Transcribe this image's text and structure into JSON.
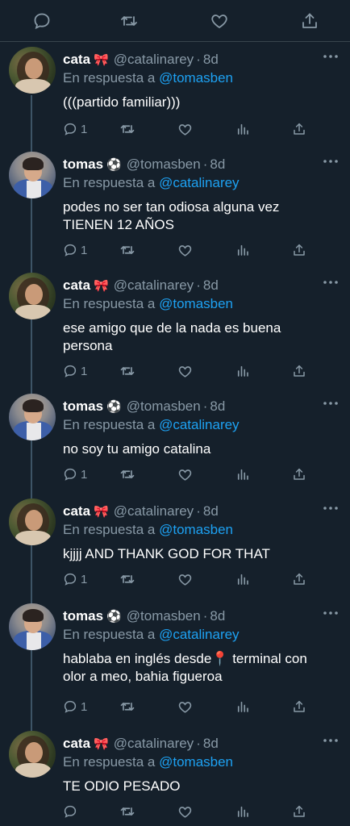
{
  "colors": {
    "background": "#15202b",
    "text": "#ffffff",
    "muted": "#8899a6",
    "link": "#1da1f2",
    "divider": "#38444d"
  },
  "top_action_bar": {
    "icons": [
      "reply-icon",
      "retweet-icon",
      "like-icon",
      "share-icon"
    ]
  },
  "tweets": [
    {
      "name": "cata",
      "emoji": "🎀",
      "handle": "@catalinarey",
      "time": "8d",
      "reply_label": "En respuesta a",
      "reply_to": "@tomasben",
      "text_lines": [
        "(((partido familiar)))"
      ],
      "reply_count": "1"
    },
    {
      "name": "tomas",
      "emoji": "⚽",
      "handle": "@tomasben",
      "time": "8d",
      "reply_label": "En respuesta a",
      "reply_to": "@catalinarey",
      "text_lines": [
        "podes no ser tan odiosa alguna vez",
        "TIENEN 12 AÑOS"
      ],
      "reply_count": "1"
    },
    {
      "name": "cata",
      "emoji": "🎀",
      "handle": "@catalinarey",
      "time": "8d",
      "reply_label": "En respuesta a",
      "reply_to": "@tomasben",
      "text_lines": [
        "ese amigo que de la nada es buena",
        "persona"
      ],
      "reply_count": "1"
    },
    {
      "name": "tomas",
      "emoji": "⚽",
      "handle": "@tomasben",
      "time": "8d",
      "reply_label": "En respuesta a",
      "reply_to": "@catalinarey",
      "text_lines": [
        "no soy tu amigo catalina"
      ],
      "reply_count": "1"
    },
    {
      "name": "cata",
      "emoji": "🎀",
      "handle": "@catalinarey",
      "time": "8d",
      "reply_label": "En respuesta a",
      "reply_to": "@tomasben",
      "text_lines": [
        "kjjjj AND THANK GOD FOR THAT"
      ],
      "reply_count": "1"
    },
    {
      "name": "tomas",
      "emoji": "⚽",
      "handle": "@tomasben",
      "time": "8d",
      "reply_label": "En respuesta a",
      "reply_to": "@catalinarey",
      "text_lines": [
        "hablaba en inglés desde📍 terminal con",
        "olor a meo, bahia figueroa"
      ],
      "reply_count": "1"
    },
    {
      "name": "cata",
      "emoji": "🎀",
      "handle": "@catalinarey",
      "time": "8d",
      "reply_label": "En respuesta a",
      "reply_to": "@tomasben",
      "text_lines": [
        "TE ODIO PESADO"
      ],
      "reply_count": ""
    }
  ]
}
